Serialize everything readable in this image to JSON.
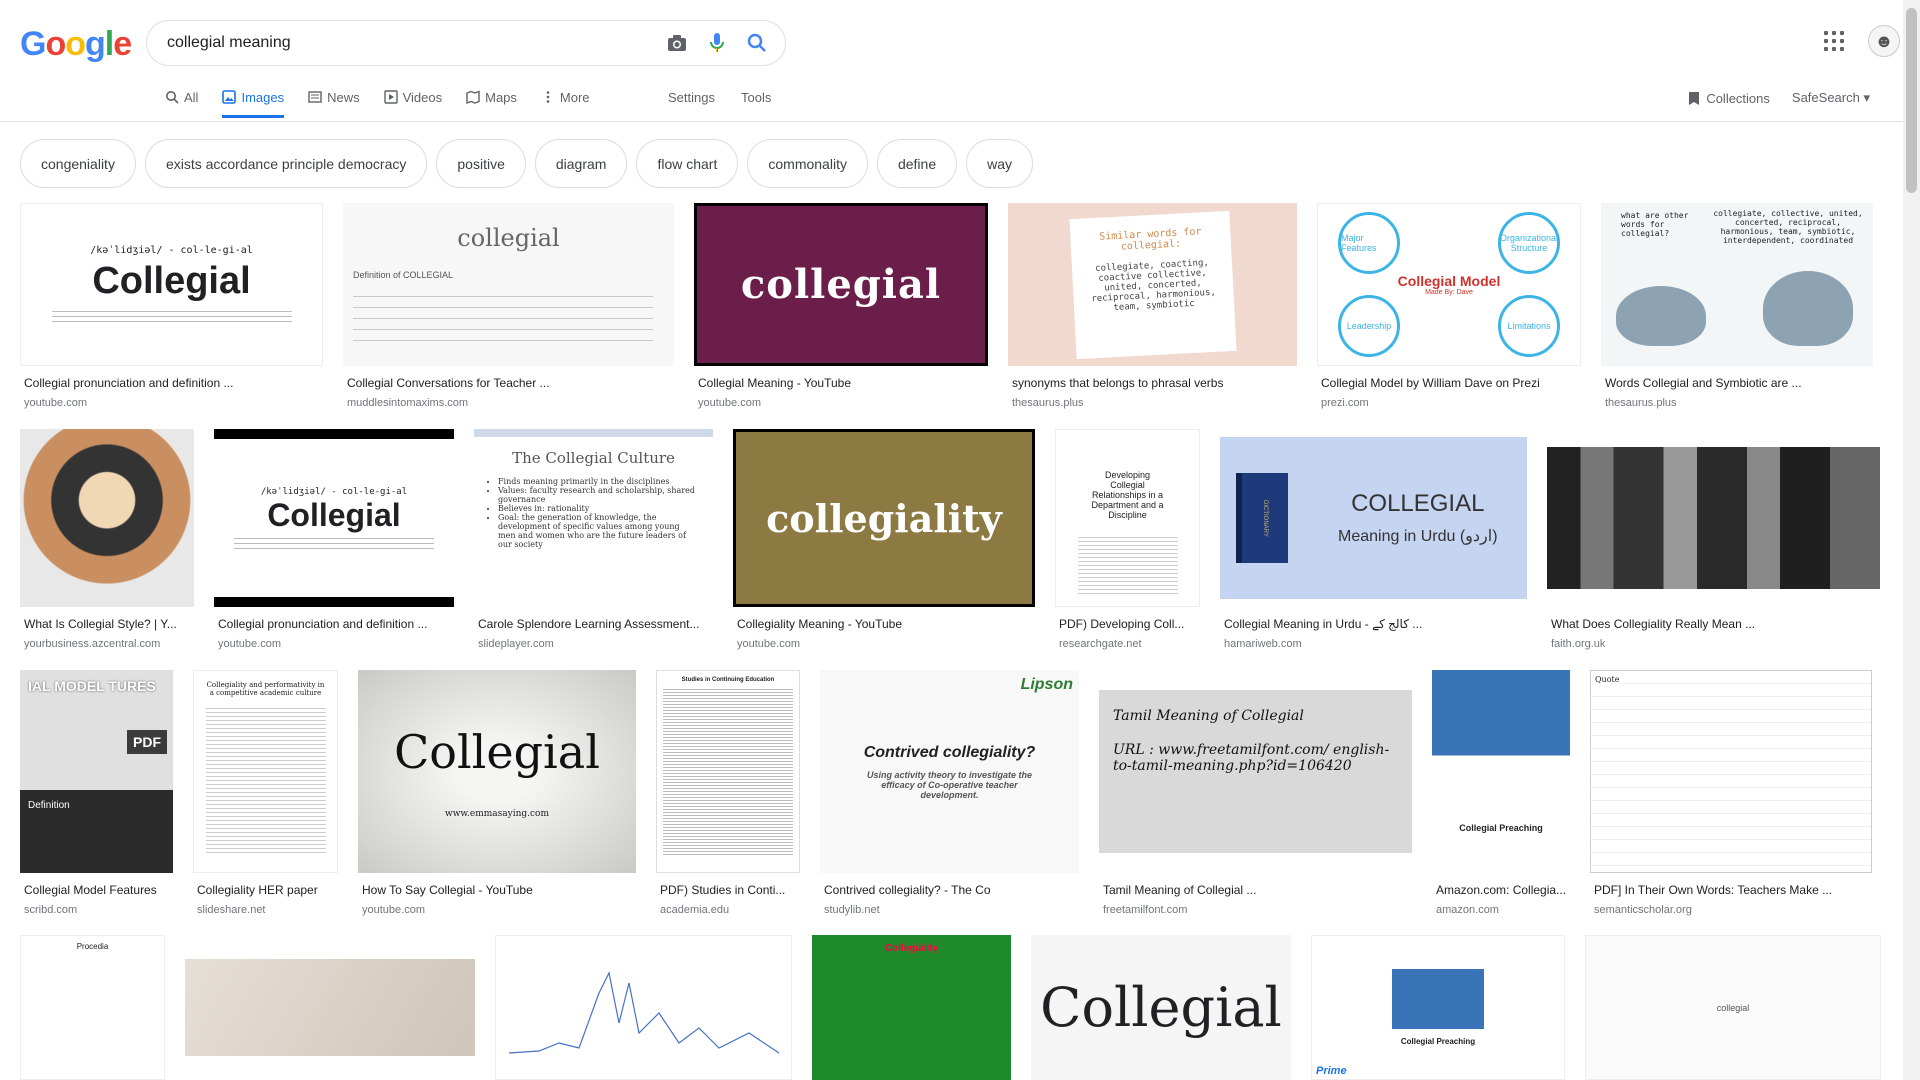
{
  "logo": {
    "letters": [
      "G",
      "o",
      "o",
      "g",
      "l",
      "e"
    ],
    "colors": [
      "#4285f4",
      "#ea4335",
      "#fbbc05",
      "#4285f4",
      "#34a853",
      "#ea4335"
    ]
  },
  "search": {
    "query": "collegial meaning"
  },
  "tabs": [
    {
      "label": "All",
      "icon": "search-icon"
    },
    {
      "label": "Images",
      "icon": "image-icon",
      "active": true
    },
    {
      "label": "News",
      "icon": "news-icon"
    },
    {
      "label": "Videos",
      "icon": "video-icon"
    },
    {
      "label": "Maps",
      "icon": "map-icon"
    },
    {
      "label": "More",
      "icon": "more-icon"
    }
  ],
  "tools": {
    "settings": "Settings",
    "tools": "Tools"
  },
  "right": {
    "collections": "Collections",
    "safesearch": "SafeSearch"
  },
  "chips": [
    "congeniality",
    "exists accordance principle democracy",
    "positive",
    "diagram",
    "flow chart",
    "commonality",
    "define",
    "way"
  ],
  "results": {
    "row1": [
      {
        "title": "Collegial pronunciation and definition ...",
        "source": "youtube.com",
        "text": "Collegial",
        "sub": "/kəˈlidʒiəl/ - col-le-gi-al"
      },
      {
        "title": "Collegial Conversations for Teacher ...",
        "source": "muddlesintomaxims.com",
        "text": "collegial",
        "sub": "Definition of COLLEGIAL"
      },
      {
        "title": "Collegial Meaning - YouTube",
        "source": "youtube.com",
        "text": "collegial"
      },
      {
        "title": "synonyms that belongs to phrasal verbs",
        "source": "thesaurus.plus",
        "text": "Similar words for collegial:",
        "sub": "collegiate, coacting, coactive collective, united, concerted, reciprocal, harmonious, team, symbiotic"
      },
      {
        "title": "Collegial Model by William Dave on Prezi",
        "source": "prezi.com",
        "text": "Collegial Model",
        "sub": "Made By: Dave",
        "bubbles": [
          "Major Features",
          "Organizational Structure",
          "Leadership",
          "Limitations"
        ]
      },
      {
        "title": "Words Collegial and Symbiotic are ...",
        "source": "thesaurus.plus",
        "text": "what are other words for collegial?",
        "sub": "collegiate, collective, united, concerted, reciprocal, harmonious, team, symbiotic, interdependent, coordinated"
      }
    ],
    "row2": [
      {
        "title": "What Is Collegial Style? | Y...",
        "source": "yourbusiness.azcentral.com"
      },
      {
        "title": "Collegial pronunciation and definition ...",
        "source": "youtube.com",
        "text": "Collegial",
        "sub": "/kəˈlidʒiəl/ - col-le-gi-al"
      },
      {
        "title": "Carole Splendore Learning Assessment...",
        "source": "slideplayer.com",
        "text": "The Collegial Culture",
        "bullets": [
          "Finds meaning primarily in the disciplines",
          "Values: faculty research and scholarship, shared governance",
          "Believes in: rationality",
          "Goal: the generation of knowledge, the development of specific values among young men and women who are the future leaders of our society"
        ]
      },
      {
        "title": "Collegiality Meaning - YouTube",
        "source": "youtube.com",
        "text": "collegiality"
      },
      {
        "title": "PDF) Developing Coll...",
        "source": "researchgate.net",
        "text": "Developing Collegial Relationships in a Department and a Discipline"
      },
      {
        "title": "Collegial Meaning in Urdu - کالج کے ...",
        "source": "hamariweb.com",
        "text": "COLLEGIAL",
        "sub": "Meaning in Urdu (اردو)",
        "book": "DICTIONARY"
      },
      {
        "title": "What Does Collegiality Really Mean ...",
        "source": "faith.org.uk"
      }
    ],
    "row3": [
      {
        "title": "Collegial Model Features",
        "source": "scribd.com",
        "text": "IAL MODEL TURES",
        "sub": "Definition",
        "badge": "PDF"
      },
      {
        "title": "Collegiality HER paper",
        "source": "slideshare.net",
        "text": "Collegiality and performativity in a competitive academic culture"
      },
      {
        "title": "How To Say Collegial - YouTube",
        "source": "youtube.com",
        "text": "Collegial",
        "sub": "www.emmasaying.com"
      },
      {
        "title": "PDF) Studies in Conti...",
        "source": "academia.edu",
        "text": "Studies in Continuing Education"
      },
      {
        "title": "Contrived collegiality? - The Co",
        "source": "studylib.net",
        "text": "Contrived collegiality?",
        "sub": "Using activity theory to investigate the efficacy of Co-operative teacher development.",
        "logo": "Lipson"
      },
      {
        "title": "Tamil Meaning of Collegial ...",
        "source": "freetamilfont.com",
        "text": "Tamil Meaning of Collegial",
        "sub": "URL : www.freetamilfont.com/ english-to-tamil-meaning.php?id=106420"
      },
      {
        "title": "Amazon.com: Collegia...",
        "source": "amazon.com",
        "text": "Collegial Preaching"
      },
      {
        "title": "PDF] In Their Own Words: Teachers Make ...",
        "source": "semanticscholar.org",
        "text": "Quote"
      }
    ],
    "row4": [
      {
        "text": "Procedia"
      },
      {
        "text": ""
      },
      {
        "text": ""
      },
      {
        "text": "Collegiality"
      },
      {
        "text": "Collegial"
      },
      {
        "text": "Collegial Preaching",
        "sub": "Prime"
      },
      {
        "text": "collegial"
      }
    ]
  }
}
